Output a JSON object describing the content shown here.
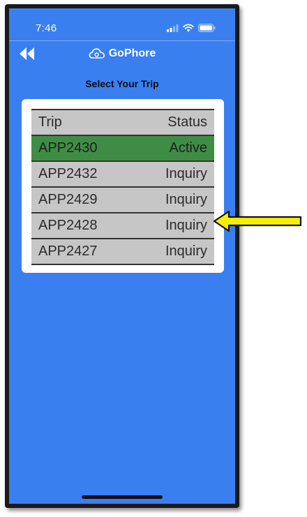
{
  "status_bar": {
    "time": "7:46",
    "icons": [
      "cellular-signal-icon",
      "wifi-icon",
      "battery-icon"
    ]
  },
  "nav": {
    "back_icon": "double-chevron-left-icon",
    "brand_icon": "cloud-icon",
    "brand_name": "GoPhore"
  },
  "page": {
    "title": "Select Your Trip"
  },
  "table": {
    "columns": [
      "Trip",
      "Status"
    ],
    "rows": [
      {
        "trip": "APP2430",
        "status": "Active"
      },
      {
        "trip": "APP2432",
        "status": "Inquiry"
      },
      {
        "trip": "APP2429",
        "status": "Inquiry"
      },
      {
        "trip": "APP2428",
        "status": "Inquiry"
      },
      {
        "trip": "APP2427",
        "status": "Inquiry"
      }
    ]
  },
  "colors": {
    "screen_bg": "#3a7ff0",
    "row_bg": "#c6c6c6",
    "active_row_bg": "#3f8d45",
    "arrow_fill": "#f6f000"
  }
}
